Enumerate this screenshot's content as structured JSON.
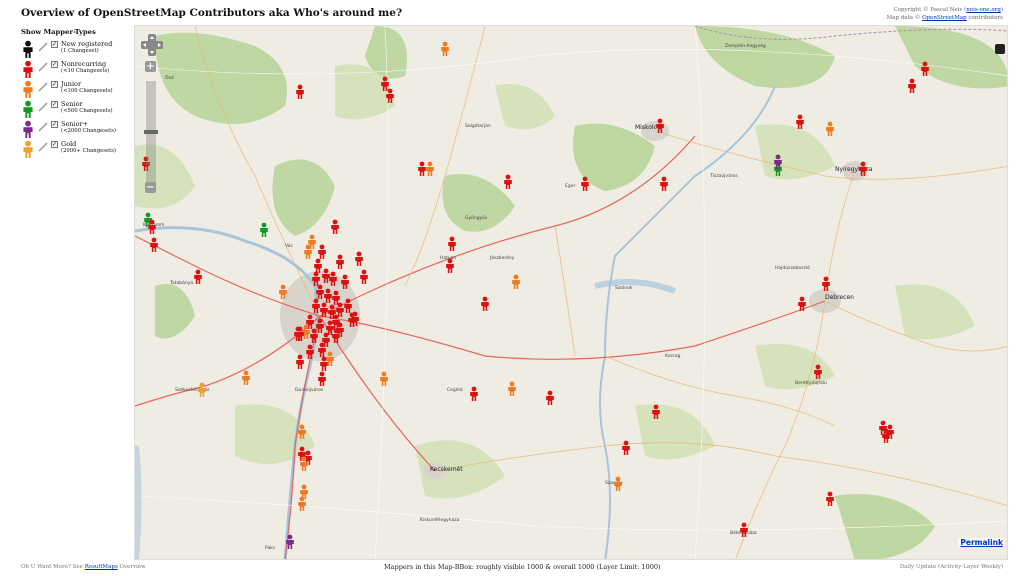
{
  "header": {
    "title": "Overview of OpenStreetMap Contributors aka Who's around me?",
    "copyright_line1_prefix": "Copyright © Pascal Neis",
    "copyright_line1_link": "neis-one.org",
    "copyright_line2_prefix": "Map data ©",
    "copyright_line2_link": "OpenStreetMap",
    "copyright_line2_suffix": "contributors"
  },
  "legend": {
    "title": "Show Mapper-Types",
    "items": [
      {
        "name": "New registered",
        "sub": "(1 Changeset)",
        "color": "#111111",
        "checked": true
      },
      {
        "name": "Nonrecurring",
        "sub": "(<10 Changesets)",
        "color": "#dd1111",
        "checked": true
      },
      {
        "name": "Junior",
        "sub": "(<100 Changesets)",
        "color": "#ee7a22",
        "checked": true
      },
      {
        "name": "Senior",
        "sub": "(<500 Changesets)",
        "color": "#119922",
        "checked": true
      },
      {
        "name": "Senior+",
        "sub": "(<2000 Changesets)",
        "color": "#7a2a88",
        "checked": true
      },
      {
        "name": "Gold",
        "sub": "(2000+ Changesets)",
        "color": "#f0a030",
        "checked": true
      }
    ]
  },
  "map": {
    "permalink": "Permalink",
    "zoom_in": "+",
    "zoom_out": "−",
    "towns": [
      {
        "name": "Miskolc",
        "big": true
      },
      {
        "name": "Debrecen",
        "big": true
      },
      {
        "name": "Nyíregyháza",
        "big": true
      },
      {
        "name": "Eger",
        "big": false
      },
      {
        "name": "Salgótarján",
        "big": false
      },
      {
        "name": "Szolnok",
        "big": false
      },
      {
        "name": "Kecskemét",
        "big": true
      },
      {
        "name": "Cegléd",
        "big": false
      },
      {
        "name": "Székesfehérvár",
        "big": false
      },
      {
        "name": "Hatvan",
        "big": false
      },
      {
        "name": "Gyöngyös",
        "big": false
      },
      {
        "name": "Jászberény",
        "big": false
      },
      {
        "name": "Békéscsaba",
        "big": false
      },
      {
        "name": "Tiszaújváros",
        "big": false
      },
      {
        "name": "Tatabánya",
        "big": false
      },
      {
        "name": "Komárom",
        "big": false
      },
      {
        "name": "Dunaújváros",
        "big": false
      },
      {
        "name": "Kiskunfélegyháza",
        "big": false
      },
      {
        "name": "Paks",
        "big": false
      },
      {
        "name": "Karcag",
        "big": false
      },
      {
        "name": "Hajdúszoboszló",
        "big": false
      },
      {
        "name": "Berettyóújfalu",
        "big": false
      },
      {
        "name": "Szarvas",
        "big": false
      },
      {
        "name": "Ózd",
        "big": false
      },
      {
        "name": "Vác",
        "big": false
      },
      {
        "name": "Zemplén-hegység",
        "big": false
      }
    ],
    "mappers": [
      {
        "type": "Nonrecurring",
        "color": "#dd1111"
      },
      {
        "type": "Junior",
        "color": "#ee7a22"
      },
      {
        "type": "Senior",
        "color": "#119922"
      },
      {
        "type": "Senior+",
        "color": "#7a2a88"
      },
      {
        "type": "Gold",
        "color": "#f0a030"
      }
    ]
  },
  "footer": {
    "left_prefix": "Oh U Want More? See",
    "left_link": "ResultMaps",
    "left_suffix": "Overview",
    "middle": "Mappers in this Map-BBox: roughly visible 1000 & overall 1000 (Layer Limit: 1000)",
    "right": "Daily Update (Activity-Layer Weekly)"
  }
}
